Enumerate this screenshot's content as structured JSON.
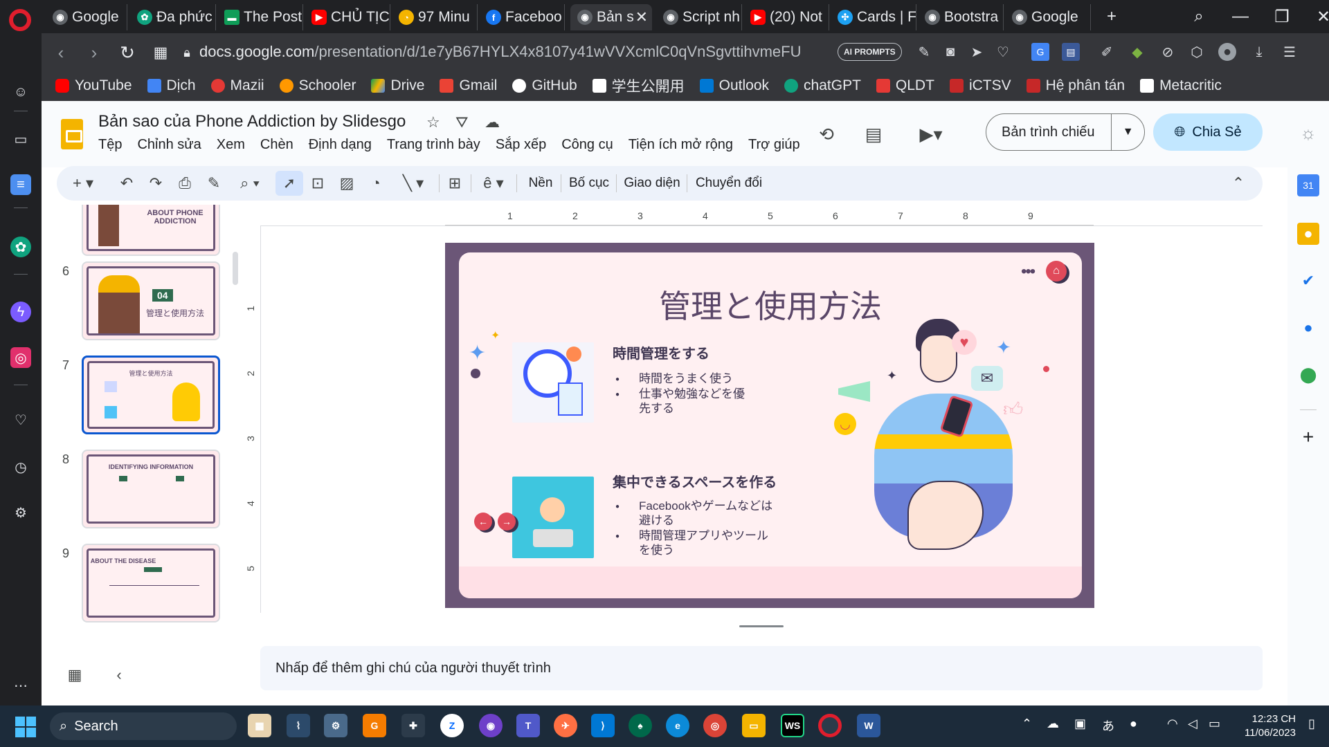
{
  "browser": {
    "tabs": [
      {
        "label": "Google",
        "color": "#5f6368"
      },
      {
        "label": "Đa phức",
        "color": "#10a37f"
      },
      {
        "label": "The Post",
        "color": "#0f9d58"
      },
      {
        "label": "CHỦ TỊC",
        "color": "#ff0000"
      },
      {
        "label": "97 Minu",
        "color": "#f4b400"
      },
      {
        "label": "Faceboo",
        "color": "#1877f2"
      },
      {
        "label": "Bản s",
        "color": "#5f6368"
      },
      {
        "label": "Script nh",
        "color": "#5f6368"
      },
      {
        "label": "(20) Not",
        "color": "#ff0000"
      },
      {
        "label": "Cards | F",
        "color": "#1da1f2"
      },
      {
        "label": "Bootstra",
        "color": "#5f6368"
      },
      {
        "label": "Google",
        "color": "#5f6368"
      }
    ],
    "url_domain": "docs.google.com",
    "url_path": "/presentation/d/1e7yB67HYLX4x8107y41wVVXcmlC0qVnSgvttihvmeFU",
    "ai_badge": "AI PROMPTS",
    "bookmarks": [
      {
        "label": "YouTube",
        "color": "#ff0000"
      },
      {
        "label": "Dịch",
        "color": "#4285f4"
      },
      {
        "label": "Mazii",
        "color": "#e53935"
      },
      {
        "label": "Schooler",
        "color": "#ff9800"
      },
      {
        "label": "Drive",
        "color": "#0f9d58"
      },
      {
        "label": "Gmail",
        "color": "#ea4335"
      },
      {
        "label": "GitHub",
        "color": "#ffffff"
      },
      {
        "label": "学生公開用",
        "color": "#ffffff"
      },
      {
        "label": "Outlook",
        "color": "#0078d4"
      },
      {
        "label": "chatGPT",
        "color": "#10a37f"
      },
      {
        "label": "QLDT",
        "color": "#e53935"
      },
      {
        "label": "iCTSV",
        "color": "#c62828"
      },
      {
        "label": "Hệ phân tán",
        "color": "#c62828"
      },
      {
        "label": "Metacritic",
        "color": "#ffffff"
      }
    ]
  },
  "docs": {
    "title": "Bản sao của Phone Addiction by Slidesgo",
    "menu": [
      "Tệp",
      "Chỉnh sửa",
      "Xem",
      "Chèn",
      "Định dạng",
      "Trang trình bày",
      "Sắp xếp",
      "Công cụ",
      "Tiện ích mở rộng",
      "Trợ giúp"
    ],
    "present_label": "Bản trình chiếu",
    "share_label": "Chia Sẻ",
    "toolbar": {
      "background": "Nền",
      "layout": "Bố cục",
      "theme": "Giao diện",
      "transition": "Chuyển đổi"
    },
    "notes_placeholder": "Nhấp để thêm ghi chú của người thuyết trình"
  },
  "ruler": {
    "h_ticks": [
      "1",
      "2",
      "3",
      "4",
      "5",
      "6",
      "7",
      "8",
      "9"
    ],
    "v_ticks": [
      "1",
      "2",
      "3",
      "4",
      "5"
    ]
  },
  "filmstrip": [
    {
      "number": "",
      "title": "ABOUT PHONE ADDICTION"
    },
    {
      "number": "6",
      "title": "管理と使用方法",
      "badge": "04"
    },
    {
      "number": "7",
      "title": "管理と使用方法",
      "selected": true
    },
    {
      "number": "8",
      "title": "IDENTIFYING INFORMATION"
    },
    {
      "number": "9",
      "title": "ABOUT THE DISEASE"
    }
  ],
  "slide": {
    "title": "管理と使用方法",
    "section1": {
      "heading": "時間管理をする",
      "bullets": [
        "時間をうまく使う",
        "仕事や勉強などを優先する"
      ]
    },
    "section2": {
      "heading": "集中できるスペースを作る",
      "bullets": [
        "Facebookやゲームなどは避ける",
        "時間管理アプリやツールを使う"
      ]
    },
    "colors": {
      "frame": "#6b5677",
      "card": "#fff0f2",
      "title": "#5a4668",
      "accent": "#e04a5a"
    }
  },
  "taskbar": {
    "search_label": "Search",
    "time": "12:23 CH",
    "date": "11/06/2023"
  }
}
